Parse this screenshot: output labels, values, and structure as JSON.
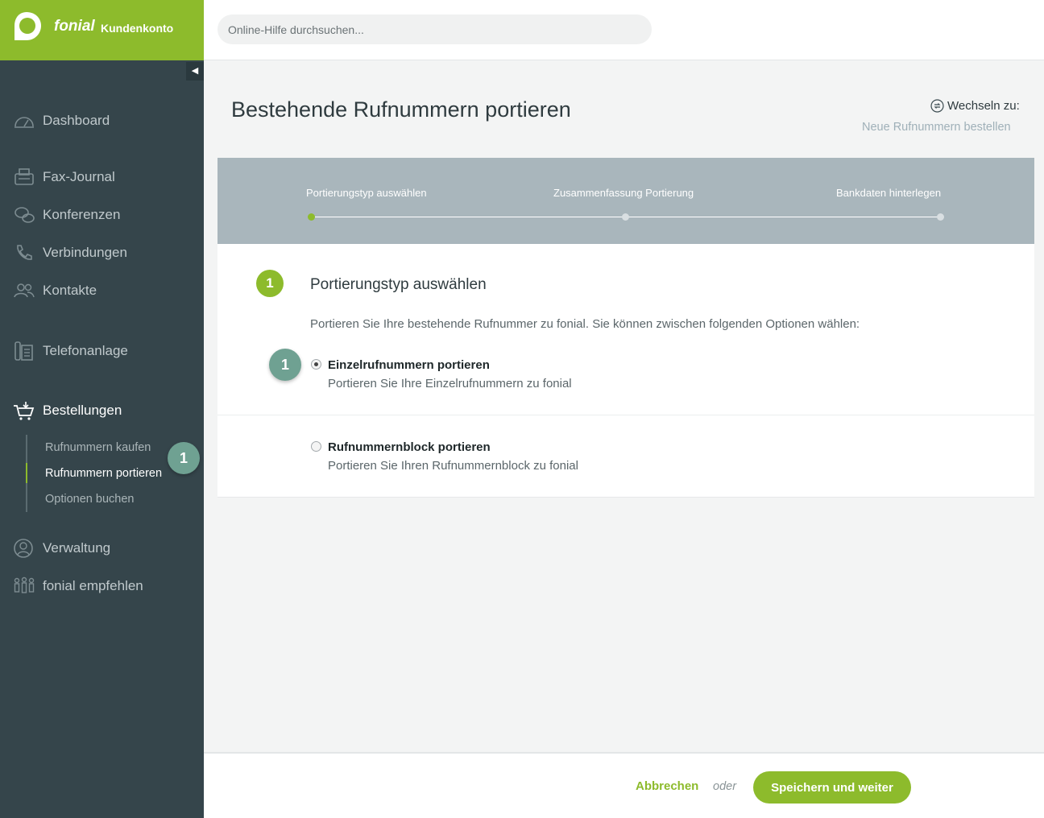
{
  "brand": {
    "name": "fonial",
    "subtitle": "Kundenkonto",
    "color": "#8dbb2c"
  },
  "search": {
    "placeholder": "Online-Hilfe durchsuchen..."
  },
  "sidebar": {
    "items": [
      {
        "label": "Dashboard",
        "icon": "gauge-icon"
      },
      {
        "label": "Fax-Journal",
        "icon": "fax-icon"
      },
      {
        "label": "Konferenzen",
        "icon": "conference-icon"
      },
      {
        "label": "Verbindungen",
        "icon": "phone-icon"
      },
      {
        "label": "Kontakte",
        "icon": "contacts-icon"
      },
      {
        "label": "Telefonanlage",
        "icon": "pbx-icon"
      },
      {
        "label": "Bestellungen",
        "icon": "cart-icon"
      },
      {
        "label": "Verwaltung",
        "icon": "user-icon"
      },
      {
        "label": "fonial empfehlen",
        "icon": "people-icon"
      }
    ],
    "sub_items": [
      {
        "label": "Rufnummern kaufen"
      },
      {
        "label": "Rufnummern portieren"
      },
      {
        "label": "Optionen buchen"
      }
    ],
    "badge": "1"
  },
  "page": {
    "title": "Bestehende Rufnummern portieren",
    "switch_label": "Wechseln zu:",
    "switch_link": "Neue Rufnummern bestellen"
  },
  "stepper": {
    "steps": [
      {
        "label": "Portierungstyp auswählen"
      },
      {
        "label": "Zusammenfassung Portierung"
      },
      {
        "label": "Bankdaten hinterlegen"
      }
    ],
    "current_step": 1
  },
  "card": {
    "step_number": "1",
    "title": "Portierungstyp auswählen",
    "description": "Portieren Sie Ihre bestehende Rufnummer zu fonial. Sie können zwischen folgenden Optionen wählen:",
    "badge": "1",
    "options": [
      {
        "title": "Einzelrufnummern portieren",
        "description": "Portieren Sie Ihre Einzelrufnummern zu fonial",
        "selected": true
      },
      {
        "title": "Rufnummernblock portieren",
        "description": "Portieren Sie Ihren Rufnummernblock zu fonial",
        "selected": false
      }
    ]
  },
  "footer": {
    "cancel_label": "Abbrechen",
    "or_label": "oder",
    "save_label": "Speichern und weiter"
  }
}
